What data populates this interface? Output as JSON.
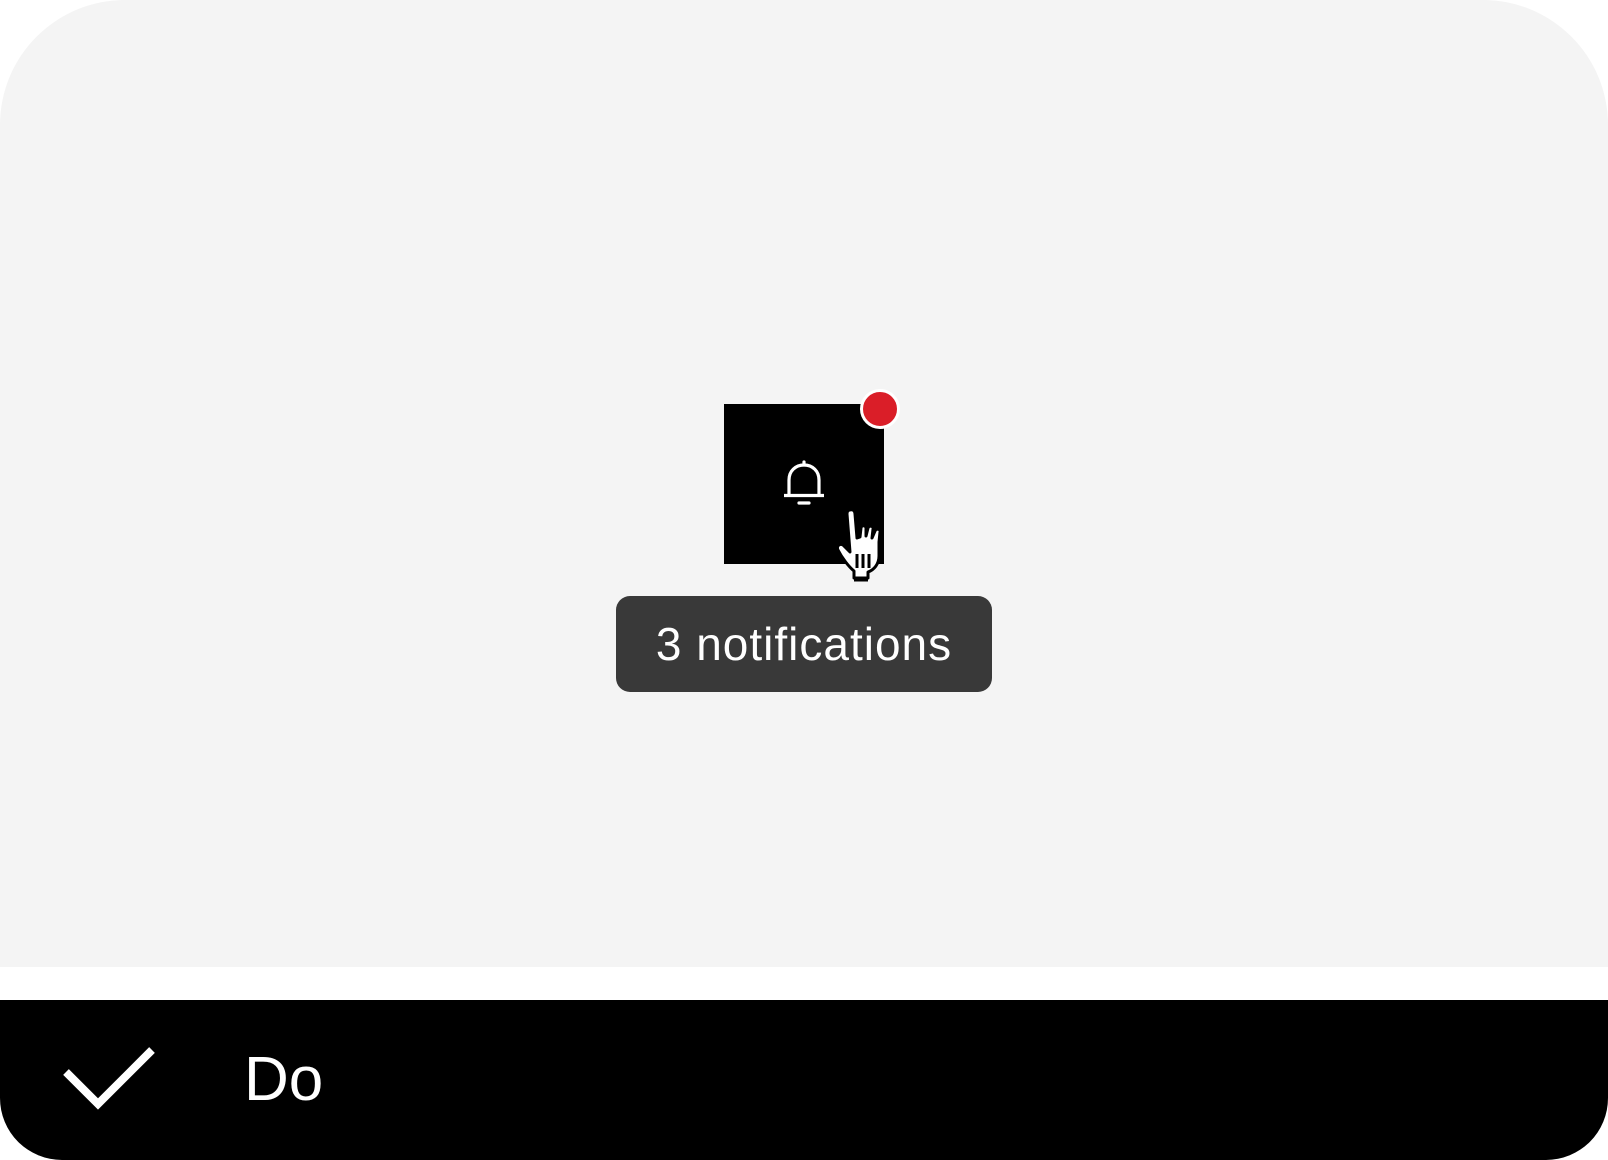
{
  "tooltip": {
    "text": "3 notifications"
  },
  "notification_button": {
    "icon": "bell-icon",
    "badge_color": "#da1e28",
    "button_color": "#000000"
  },
  "cursor": {
    "icon": "pointer-hand-icon"
  },
  "footer": {
    "icon": "checkmark-icon",
    "label": "Do"
  },
  "colors": {
    "canvas_background": "#f4f4f4",
    "tooltip_background": "#393939",
    "footer_background": "#000000"
  }
}
